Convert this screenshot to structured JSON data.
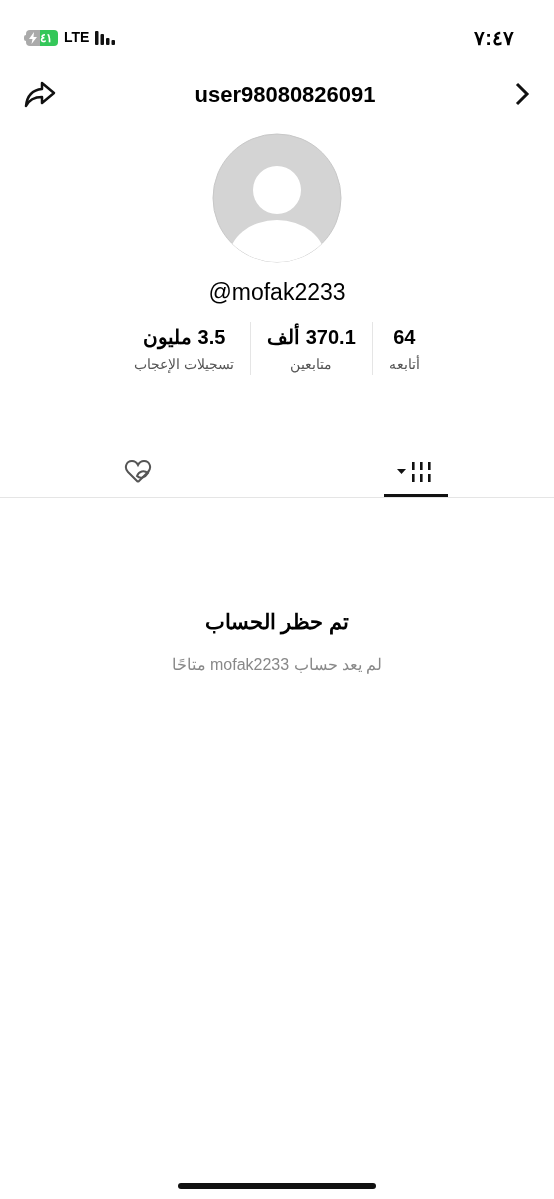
{
  "status_bar": {
    "time": "٧:٤٧",
    "battery": "٤١",
    "network": "LTE"
  },
  "header": {
    "title": "user98080826091"
  },
  "profile": {
    "handle": "@mofak2233"
  },
  "stats": [
    {
      "value": "64",
      "label": "أتابعه"
    },
    {
      "value": "370.1 ألف",
      "label": "متابعين"
    },
    {
      "value": "3.5 مليون",
      "label": "تسجيلات الإعجاب"
    }
  ],
  "tabs": [
    {
      "kind": "videos",
      "selected": true
    },
    {
      "kind": "liked",
      "selected": false
    }
  ],
  "notice": {
    "title": "تم حظر الحساب",
    "message": "لم يعد حساب mofak2233 متاحًا"
  }
}
